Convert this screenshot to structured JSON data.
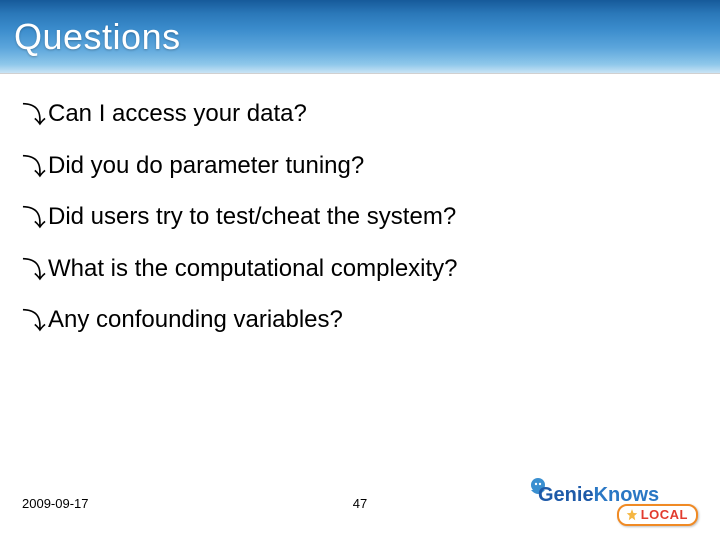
{
  "title": "Questions",
  "bullets": [
    "Can I access your data?",
    "Did you do parameter tuning?",
    "Did users try to test/cheat the system?",
    "What is the computational complexity?",
    "Any confounding variables?"
  ],
  "footer": {
    "date": "2009-09-17",
    "page": "47"
  },
  "logo": {
    "brand1": "Genie",
    "brand2": "Knows",
    "sub": "LOCAL"
  }
}
